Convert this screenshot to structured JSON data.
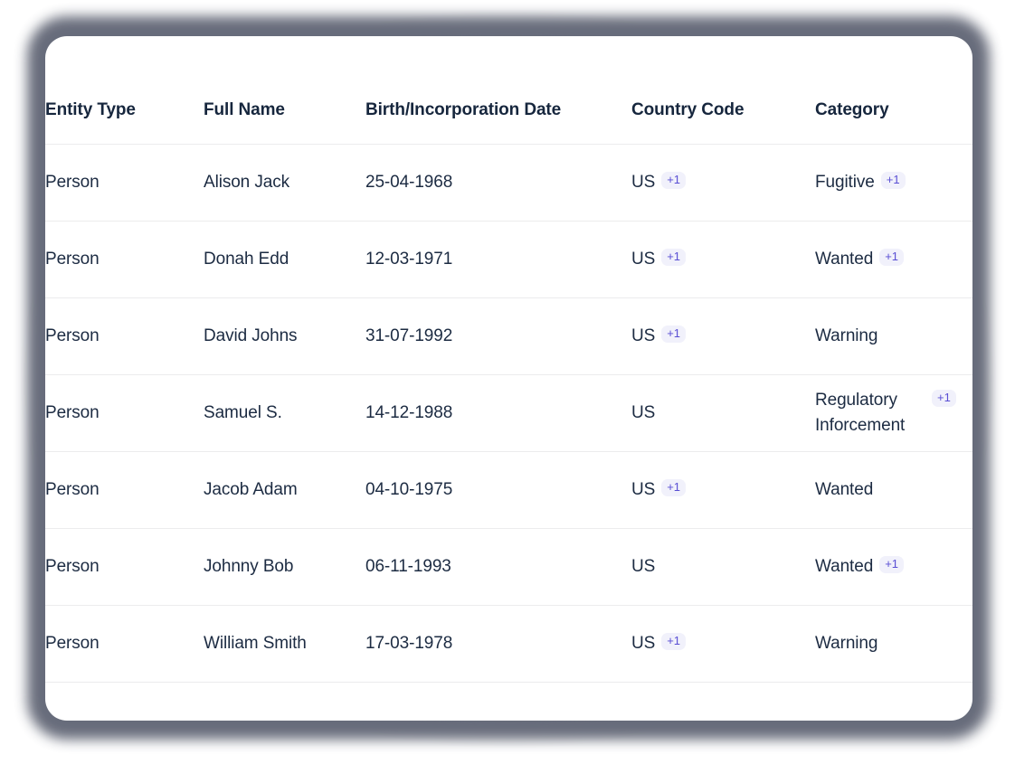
{
  "card": {
    "accent_badge_bg": "#f1f1fb",
    "accent_badge_fg": "#5a4fd4",
    "text_color": "#1c2b42",
    "header_color": "#16263d",
    "divider_color": "#ececed",
    "card_bg": "#ffffff",
    "shadow_color": "#5b6070"
  },
  "table": {
    "columns": [
      {
        "key": "entity_type",
        "label": "Entity Type"
      },
      {
        "key": "full_name",
        "label": "Full Name"
      },
      {
        "key": "birth_date",
        "label": "Birth/Incorporation Date"
      },
      {
        "key": "country_code",
        "label": "Country Code"
      },
      {
        "key": "category",
        "label": "Category"
      }
    ],
    "rows": [
      {
        "entity_type": "Person",
        "full_name": "Alison Jack",
        "birth_date": "25-04-1968",
        "country_code": "US",
        "country_more": "+1",
        "category": "Fugitive",
        "category_more": "+1"
      },
      {
        "entity_type": "Person",
        "full_name": "Donah Edd",
        "birth_date": "12-03-1971",
        "country_code": "US",
        "country_more": "+1",
        "category": "Wanted",
        "category_more": "+1"
      },
      {
        "entity_type": "Person",
        "full_name": "David Johns",
        "birth_date": "31-07-1992",
        "country_code": "US",
        "country_more": "+1",
        "category": "Warning",
        "category_more": ""
      },
      {
        "entity_type": "Person",
        "full_name": "Samuel S.",
        "birth_date": "14-12-1988",
        "country_code": "US",
        "country_more": "",
        "category": "Regulatory Inforcement",
        "category_more": "+1"
      },
      {
        "entity_type": "Person",
        "full_name": "Jacob Adam",
        "birth_date": "04-10-1975",
        "country_code": "US",
        "country_more": "+1",
        "category": "Wanted",
        "category_more": ""
      },
      {
        "entity_type": "Person",
        "full_name": "Johnny Bob",
        "birth_date": "06-11-1993",
        "country_code": "US",
        "country_more": "",
        "category": "Wanted",
        "category_more": "+1"
      },
      {
        "entity_type": "Person",
        "full_name": "William Smith",
        "birth_date": "17-03-1978",
        "country_code": "US",
        "country_more": "+1",
        "category": "Warning",
        "category_more": ""
      }
    ]
  }
}
